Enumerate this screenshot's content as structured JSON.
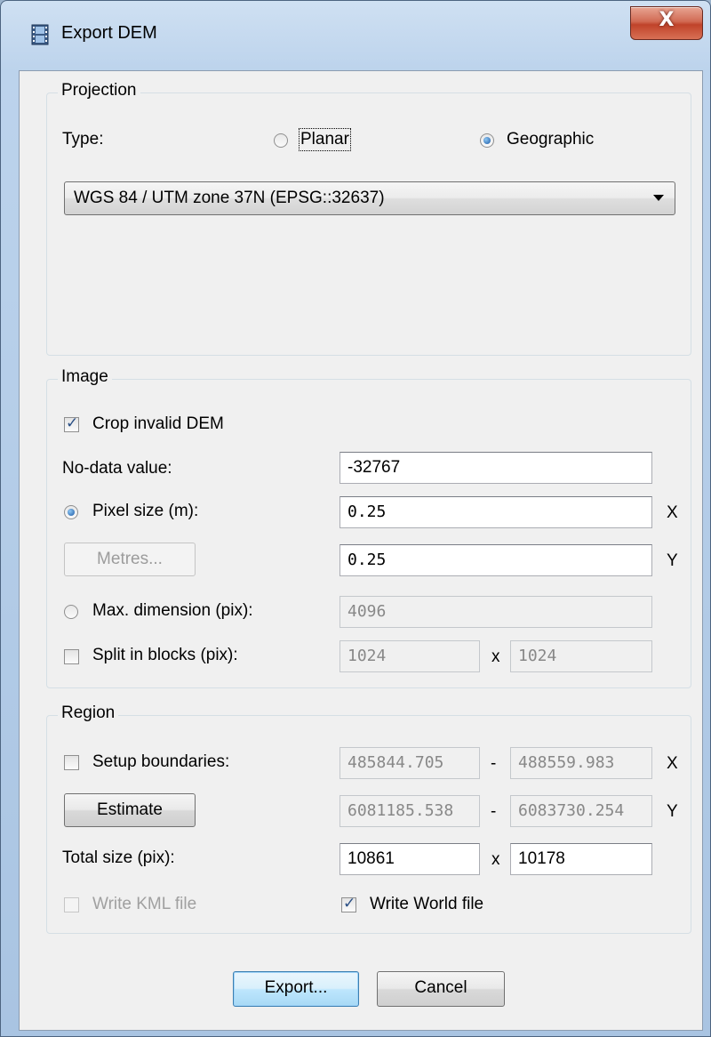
{
  "window": {
    "title": "Export DEM",
    "close_label": "X"
  },
  "projection": {
    "group_label": "Projection",
    "type_label": "Type:",
    "planar_label": "Planar",
    "geographic_label": "Geographic",
    "selected_type": "Geographic",
    "crs_value": "WGS 84 / UTM zone 37N (EPSG::32637)"
  },
  "image": {
    "group_label": "Image",
    "crop_label": "Crop invalid DEM",
    "crop_checked": true,
    "nodata_label": "No-data value:",
    "nodata_value": "-32767",
    "pixel_size_label": "Pixel size (m):",
    "pixel_x": "0.25",
    "pixel_y": "0.25",
    "x_suffix": "X",
    "y_suffix": "Y",
    "metres_button": "Metres...",
    "max_dim_label": "Max. dimension (pix):",
    "max_dim_value": "4096",
    "split_label": "Split in blocks (pix):",
    "split_x": "1024",
    "split_y": "1024",
    "times": "x"
  },
  "region": {
    "group_label": "Region",
    "setup_label": "Setup boundaries:",
    "x_min": "485844.705",
    "x_max": "488559.983",
    "y_min": "6081185.538",
    "y_max": "6083730.254",
    "dash": "-",
    "x_suffix": "X",
    "y_suffix": "Y",
    "estimate_button": "Estimate",
    "total_label": "Total size (pix):",
    "total_x": "10861",
    "total_y": "10178",
    "times": "x",
    "kml_label": "Write KML file",
    "world_label": "Write World file",
    "world_checked": true
  },
  "footer": {
    "export_button": "Export...",
    "cancel_button": "Cancel"
  }
}
